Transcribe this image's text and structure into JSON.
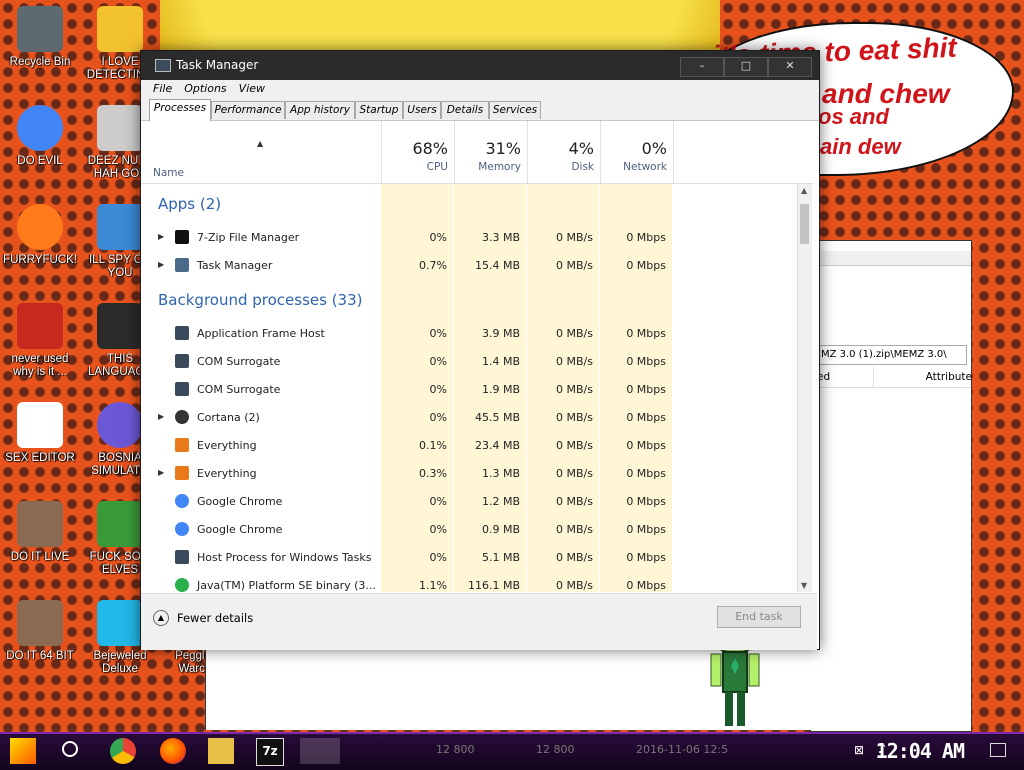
{
  "desktop": {
    "speech_lines": [
      "it's time to eat shit",
      "and chew",
      "os and",
      "ain dew"
    ],
    "icons": [
      {
        "label": "Recycle Bin",
        "icon": "recycle-bin-icon",
        "color": "#5d6a70"
      },
      {
        "label": "I LOVE DETECTING",
        "icon": "detect-icon",
        "color": "#f2c12e"
      },
      {
        "label": "DO EVIL",
        "icon": "chrome-icon",
        "color": "#4285f4"
      },
      {
        "label": "DEEZ NUTZ HAH GOT",
        "icon": "windows-icon",
        "color": "#cccccc"
      },
      {
        "label": "FURRYFUCK!",
        "icon": "firefox-icon",
        "color": "#ff7a1a"
      },
      {
        "label": "ILL SPY ON YOU",
        "icon": "spy-icon",
        "color": "#3a8ad6"
      },
      {
        "label": "never used why is it ...",
        "icon": "devcpp-icon",
        "color": "#c8281e"
      },
      {
        "label": "THIS LANGUAGE",
        "icon": "go-icon",
        "color": "#2b2b2b"
      },
      {
        "label": "SEX EDITOR",
        "icon": "hxd-icon",
        "color": "#ffffff"
      },
      {
        "label": "BOSNIA SIMULATO",
        "icon": "mine-icon",
        "color": "#6b58d6"
      },
      {
        "label": "DO IT LIVE",
        "icon": "portrait-icon",
        "color": "#8a6a50"
      },
      {
        "label": "FUCK SOM ELVES",
        "icon": "elf-icon",
        "color": "#3a9a3a"
      },
      {
        "label": "DO IT 64 BIT",
        "icon": "portrait-icon",
        "color": "#8a6a50"
      },
      {
        "label": "Bejeweled Deluxe",
        "icon": "gem-icon",
        "color": "#22b8e8"
      },
      {
        "label": "Peggle W Warcraft",
        "icon": "peggle-icon",
        "color": "#e8b83a"
      }
    ],
    "explorer_path": "MEMZ 3.0 (1).zip\\MEMZ 3.0\\",
    "explorer_col": "Attribute",
    "explorer_col_partial": "ed"
  },
  "task_manager": {
    "title": "Task Manager",
    "window_buttons": {
      "minimize": "–",
      "maximize": "□",
      "close": "✕"
    },
    "menu": [
      "File",
      "Options",
      "View"
    ],
    "tabs": [
      "Processes",
      "Performance",
      "App history",
      "Startup",
      "Users",
      "Details",
      "Services"
    ],
    "active_tab": 0,
    "columns": {
      "name": "Name",
      "cpu": {
        "pct": "68%",
        "label": "CPU"
      },
      "memory": {
        "pct": "31%",
        "label": "Memory"
      },
      "disk": {
        "pct": "4%",
        "label": "Disk"
      },
      "network": {
        "pct": "0%",
        "label": "Network"
      }
    },
    "groups": {
      "apps": "Apps (2)",
      "background": "Background processes (33)"
    },
    "apps": [
      {
        "name": "7-Zip File Manager",
        "cpu": "0%",
        "memory": "3.3 MB",
        "disk": "0 MB/s",
        "network": "0 Mbps",
        "expandable": true,
        "icon": "7zip-icon"
      },
      {
        "name": "Task Manager",
        "cpu": "0.7%",
        "memory": "15.4 MB",
        "disk": "0 MB/s",
        "network": "0 Mbps",
        "expandable": true,
        "icon": "task-manager-icon"
      }
    ],
    "background": [
      {
        "name": "Application Frame Host",
        "cpu": "0%",
        "memory": "3.9 MB",
        "disk": "0 MB/s",
        "network": "0 Mbps",
        "expandable": false,
        "icon": "process-icon"
      },
      {
        "name": "COM Surrogate",
        "cpu": "0%",
        "memory": "1.4 MB",
        "disk": "0 MB/s",
        "network": "0 Mbps",
        "expandable": false,
        "icon": "process-icon"
      },
      {
        "name": "COM Surrogate",
        "cpu": "0%",
        "memory": "1.9 MB",
        "disk": "0 MB/s",
        "network": "0 Mbps",
        "expandable": false,
        "icon": "process-icon"
      },
      {
        "name": "Cortana (2)",
        "cpu": "0%",
        "memory": "45.5 MB",
        "disk": "0 MB/s",
        "network": "0 Mbps",
        "expandable": true,
        "icon": "cortana-icon"
      },
      {
        "name": "Everything",
        "cpu": "0.1%",
        "memory": "23.4 MB",
        "disk": "0 MB/s",
        "network": "0 Mbps",
        "expandable": false,
        "icon": "search-icon"
      },
      {
        "name": "Everything",
        "cpu": "0.3%",
        "memory": "1.3 MB",
        "disk": "0 MB/s",
        "network": "0 Mbps",
        "expandable": true,
        "icon": "search-icon"
      },
      {
        "name": "Google Chrome",
        "cpu": "0%",
        "memory": "1.2 MB",
        "disk": "0 MB/s",
        "network": "0 Mbps",
        "expandable": false,
        "icon": "chrome-icon"
      },
      {
        "name": "Google Chrome",
        "cpu": "0%",
        "memory": "0.9 MB",
        "disk": "0 MB/s",
        "network": "0 Mbps",
        "expandable": false,
        "icon": "chrome-icon"
      },
      {
        "name": "Host Process for Windows Tasks",
        "cpu": "0%",
        "memory": "5.1 MB",
        "disk": "0 MB/s",
        "network": "0 Mbps",
        "expandable": false,
        "icon": "process-icon"
      },
      {
        "name": "Java(TM) Platform SE binary (3...",
        "cpu": "1.1%",
        "memory": "116.1 MB",
        "disk": "0 MB/s",
        "network": "0 Mbps",
        "expandable": false,
        "icon": "java-icon"
      }
    ],
    "fewer_details": "Fewer details",
    "end_task": "End task"
  },
  "taskbar": {
    "ghost_values": [
      "12 800",
      "12 800",
      "2016-11-06 12:5"
    ],
    "clock": "12:04 AM",
    "colors": {
      "accent": "#7a2aa8"
    }
  }
}
